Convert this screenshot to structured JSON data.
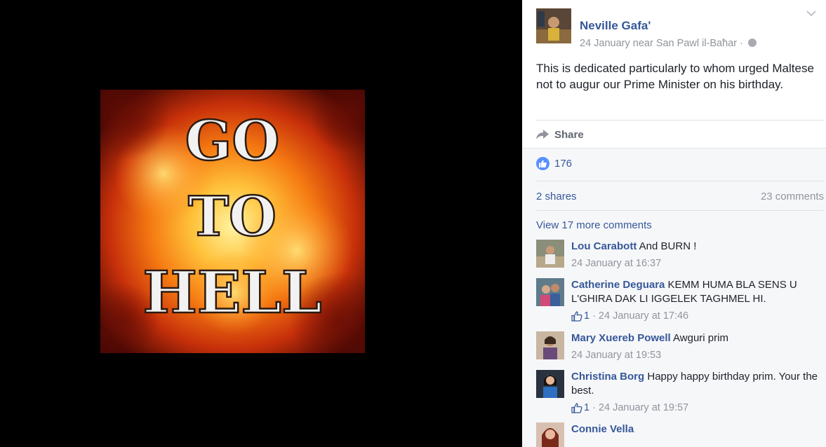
{
  "post": {
    "image_text": [
      "GO",
      "TO",
      "HELL"
    ],
    "author": "Neville Gafa'",
    "meta": "24 January near San Pawl il-Baħar ·",
    "privacy_icon": "globe-icon",
    "text": "This is dedicated particularly to whom urged Maltese not to augur our Prime Minister on his birthday."
  },
  "actions": {
    "share_label": "Share"
  },
  "stats": {
    "likes": "176",
    "shares": "2 shares",
    "comments": "23 comments"
  },
  "comments_section": {
    "view_more": "View 17 more comments",
    "items": [
      {
        "name": "Lou Carabott",
        "text": " And BURN !",
        "likes": "",
        "time": "24 January at 16:37"
      },
      {
        "name": "Catherine Deguara",
        "text": " KEMM HUMA BLA SENS U L'GHIRA DAK LI IGGELEK TAGHMEL HI.",
        "likes": "1",
        "time": "24 January at 17:46"
      },
      {
        "name": "Mary Xuereb Powell",
        "text": " Awguri prim",
        "likes": "",
        "time": "24 January at 19:53"
      },
      {
        "name": "Christina Borg",
        "text": " Happy happy birthday prim. Your the best.",
        "likes": "1",
        "time": "24 January at 19:57"
      },
      {
        "name": "Connie Vella",
        "text": "",
        "likes": "",
        "time": ""
      }
    ]
  },
  "colors": {
    "link": "#365899",
    "meta": "#90949c",
    "like_blue": "#5890ff",
    "panel_bg": "#f6f7f9"
  }
}
